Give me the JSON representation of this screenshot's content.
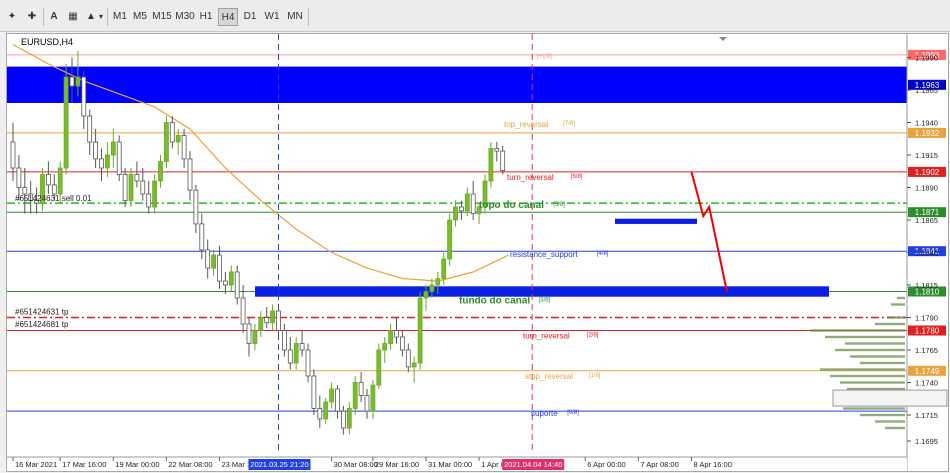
{
  "toolbar": {
    "buttons": [
      "A",
      "M1",
      "M5",
      "M15",
      "M30",
      "H1",
      "H4",
      "D1",
      "W1",
      "MN"
    ],
    "active": "H4"
  },
  "chart": {
    "symbol": "EURUSD,H4"
  },
  "chart_data": {
    "type": "candlestick",
    "symbol": "EURUSD",
    "timeframe": "H4",
    "ylim": [
      1.1685,
      1.2005
    ],
    "y_ticks": [
      1.199,
      1.1965,
      1.194,
      1.1915,
      1.189,
      1.1865,
      1.184,
      1.1815,
      1.179,
      1.1765,
      1.174,
      1.1715,
      1.1695
    ],
    "y_tick_labels": [
      "1.1990",
      "1.1965",
      "1.1940",
      "1.1915",
      "1.1890",
      "1.1865",
      "1.1840",
      "1.1815",
      "1.1790",
      "1.1765",
      "1.1740",
      "1.1715",
      "1.1695"
    ],
    "x_labels": [
      "16 Mar 2021",
      "17 Mar 16:00",
      "19 Mar 00:00",
      "22 Mar 08:00",
      "23 Mar 16:00",
      "2021.03.25 21:20",
      "30 Mar 08:00",
      "29 Mar 16:00",
      "31 Mar 00:00",
      "1 Apr 08:00",
      "2021.04.04 14:40",
      "6 Apr 00:00",
      "7 Apr 08:00",
      "8 Apr 16:00"
    ],
    "x_label_index": [
      0,
      8,
      17,
      26,
      35,
      45,
      54,
      61,
      70,
      79,
      88,
      97,
      106,
      115
    ],
    "candles": [
      [
        1.1925,
        1.194,
        1.1895,
        1.1905
      ],
      [
        1.1905,
        1.1915,
        1.188,
        1.189
      ],
      [
        1.189,
        1.1905,
        1.187,
        1.1885
      ],
      [
        1.1885,
        1.1895,
        1.187,
        1.188
      ],
      [
        1.188,
        1.189,
        1.187,
        1.1878
      ],
      [
        1.1878,
        1.1905,
        1.1872,
        1.19
      ],
      [
        1.19,
        1.191,
        1.1885,
        1.1892
      ],
      [
        1.1892,
        1.19,
        1.188,
        1.1885
      ],
      [
        1.1885,
        1.191,
        1.1878,
        1.1905
      ],
      [
        1.1905,
        1.1985,
        1.19,
        1.1975
      ],
      [
        1.1975,
        1.199,
        1.1955,
        1.1968
      ],
      [
        1.1968,
        1.1995,
        1.196,
        1.1975
      ],
      [
        1.1975,
        1.198,
        1.1935,
        1.1945
      ],
      [
        1.1945,
        1.195,
        1.1915,
        1.1925
      ],
      [
        1.1925,
        1.1935,
        1.1905,
        1.1912
      ],
      [
        1.1912,
        1.192,
        1.1895,
        1.1905
      ],
      [
        1.1905,
        1.1925,
        1.1898,
        1.1915
      ],
      [
        1.1915,
        1.1935,
        1.1905,
        1.1925
      ],
      [
        1.1925,
        1.193,
        1.1895,
        1.19
      ],
      [
        1.19,
        1.1905,
        1.1875,
        1.188
      ],
      [
        1.188,
        1.1905,
        1.1875,
        1.19
      ],
      [
        1.19,
        1.191,
        1.189,
        1.1895
      ],
      [
        1.1895,
        1.1905,
        1.188,
        1.1885
      ],
      [
        1.1885,
        1.1895,
        1.187,
        1.1875
      ],
      [
        1.1875,
        1.19,
        1.187,
        1.1895
      ],
      [
        1.1895,
        1.1915,
        1.189,
        1.191
      ],
      [
        1.191,
        1.1945,
        1.1905,
        1.194
      ],
      [
        1.194,
        1.1945,
        1.192,
        1.1925
      ],
      [
        1.1925,
        1.1935,
        1.1915,
        1.193
      ],
      [
        1.193,
        1.1935,
        1.1905,
        1.1912
      ],
      [
        1.1912,
        1.1918,
        1.188,
        1.1888
      ],
      [
        1.1888,
        1.1892,
        1.1855,
        1.1862
      ],
      [
        1.1862,
        1.187,
        1.1835,
        1.1842
      ],
      [
        1.1842,
        1.185,
        1.182,
        1.1828
      ],
      [
        1.1828,
        1.1842,
        1.1822,
        1.1838
      ],
      [
        1.1838,
        1.1845,
        1.1812,
        1.1818
      ],
      [
        1.1818,
        1.1825,
        1.1808,
        1.1815
      ],
      [
        1.1815,
        1.183,
        1.181,
        1.1825
      ],
      [
        1.1825,
        1.183,
        1.18,
        1.1805
      ],
      [
        1.1805,
        1.1815,
        1.1778,
        1.1785
      ],
      [
        1.1785,
        1.179,
        1.176,
        1.177
      ],
      [
        1.177,
        1.1785,
        1.1765,
        1.178
      ],
      [
        1.178,
        1.1795,
        1.1775,
        1.179
      ],
      [
        1.179,
        1.1798,
        1.1782,
        1.1786
      ],
      [
        1.1786,
        1.18,
        1.178,
        1.1795
      ],
      [
        1.1795,
        1.18,
        1.1775,
        1.178
      ],
      [
        1.178,
        1.1785,
        1.176,
        1.1765
      ],
      [
        1.1765,
        1.1775,
        1.175,
        1.1755
      ],
      [
        1.1755,
        1.1775,
        1.175,
        1.177
      ],
      [
        1.177,
        1.178,
        1.176,
        1.1765
      ],
      [
        1.1765,
        1.177,
        1.174,
        1.1745
      ],
      [
        1.1745,
        1.175,
        1.1715,
        1.172
      ],
      [
        1.172,
        1.173,
        1.1705,
        1.1712
      ],
      [
        1.1712,
        1.1728,
        1.1708,
        1.1725
      ],
      [
        1.1725,
        1.174,
        1.172,
        1.1735
      ],
      [
        1.1735,
        1.1738,
        1.1712,
        1.1718
      ],
      [
        1.1718,
        1.1722,
        1.17,
        1.1705
      ],
      [
        1.1705,
        1.1725,
        1.17,
        1.172
      ],
      [
        1.172,
        1.1745,
        1.1715,
        1.174
      ],
      [
        1.174,
        1.1748,
        1.1725,
        1.173
      ],
      [
        1.173,
        1.1735,
        1.1712,
        1.1718
      ],
      [
        1.1718,
        1.1742,
        1.1712,
        1.1738
      ],
      [
        1.1738,
        1.177,
        1.1735,
        1.1765
      ],
      [
        1.1765,
        1.1775,
        1.1755,
        1.177
      ],
      [
        1.177,
        1.1785,
        1.1765,
        1.178
      ],
      [
        1.178,
        1.179,
        1.177,
        1.1775
      ],
      [
        1.1775,
        1.178,
        1.176,
        1.1765
      ],
      [
        1.1765,
        1.177,
        1.1748,
        1.1752
      ],
      [
        1.1752,
        1.176,
        1.174,
        1.1755
      ],
      [
        1.1755,
        1.181,
        1.175,
        1.1805
      ],
      [
        1.1805,
        1.1815,
        1.1795,
        1.181
      ],
      [
        1.181,
        1.182,
        1.1805,
        1.1815
      ],
      [
        1.1815,
        1.1825,
        1.1808,
        1.182
      ],
      [
        1.182,
        1.184,
        1.1815,
        1.1835
      ],
      [
        1.1835,
        1.187,
        1.183,
        1.1865
      ],
      [
        1.1865,
        1.188,
        1.186,
        1.1875
      ],
      [
        1.1875,
        1.188,
        1.1865,
        1.1872
      ],
      [
        1.1872,
        1.189,
        1.1868,
        1.1885
      ],
      [
        1.1885,
        1.1895,
        1.1865,
        1.187
      ],
      [
        1.187,
        1.1878,
        1.1862,
        1.1875
      ],
      [
        1.1875,
        1.19,
        1.187,
        1.1895
      ],
      [
        1.1895,
        1.1925,
        1.189,
        1.192
      ],
      [
        1.192,
        1.1925,
        1.191,
        1.1918
      ],
      [
        1.1918,
        1.1922,
        1.19,
        1.1903
      ]
    ],
    "ma_line": [
      [
        0,
        1.2
      ],
      [
        6,
        1.1985
      ],
      [
        12,
        1.1972
      ],
      [
        18,
        1.1962
      ],
      [
        24,
        1.1952
      ],
      [
        30,
        1.1935
      ],
      [
        36,
        1.1905
      ],
      [
        42,
        1.188
      ],
      [
        48,
        1.1858
      ],
      [
        54,
        1.184
      ],
      [
        60,
        1.1828
      ],
      [
        66,
        1.182
      ],
      [
        72,
        1.1818
      ],
      [
        78,
        1.1825
      ],
      [
        84,
        1.1838
      ]
    ],
    "horizontal_lines": [
      {
        "price": 1.1992,
        "color": "#ff9999",
        "style": "solid",
        "label": "1.1993",
        "label_color": "#ff6666",
        "tag": "[+1/8]"
      },
      {
        "price": 1.1932,
        "color": "#e8a33a",
        "style": "solid",
        "label": "1.1932",
        "label_color": "#e8a33a",
        "text": "top_reversal",
        "tag": "[7/8]"
      },
      {
        "price": 1.1902,
        "color": "#e02020",
        "style": "solid",
        "label": "1.1902",
        "label_color": "#e02020",
        "text": "turn_reversal",
        "tag": "[6/8]"
      },
      {
        "price": 1.1878,
        "color": "#22bb22",
        "style": "dashdot",
        "label": "",
        "label_color": "#22bb22"
      },
      {
        "price": 1.1871,
        "color": "#2e8b2e",
        "style": "solid",
        "label": "1.1871",
        "label_color": "#2e8b2e",
        "text": "topo do canal",
        "tag": "[5/8]"
      },
      {
        "price": 1.1841,
        "color": "#2040e0",
        "style": "solid",
        "label": "1.1841",
        "label_color": "#2040e0",
        "text": "resistance_support",
        "tag": "[4/8]"
      },
      {
        "price": 1.181,
        "color": "#2e8b2e",
        "style": "solid",
        "label": "1.1810",
        "label_color": "#2e8b2e",
        "text": "fundo do canal",
        "tag": "[3/8]"
      },
      {
        "price": 1.179,
        "color": "#e02020",
        "style": "dashdot",
        "label": "",
        "label_color": "#e02020"
      },
      {
        "price": 1.178,
        "color": "#e02020",
        "style": "solid",
        "label": "1.1780",
        "label_color": "#e02020",
        "text": "turn_reversal",
        "tag": "[2/8]"
      },
      {
        "price": 1.1749,
        "color": "#e8a33a",
        "style": "solid",
        "label": "1.1749",
        "label_color": "#e8a33a",
        "text": "stop_reversal",
        "tag": "[1/8]"
      },
      {
        "price": 1.1718,
        "color": "#2040e0",
        "style": "solid",
        "label": "",
        "label_color": "#2040e0",
        "text": "suporte",
        "tag": "[0/8]"
      }
    ],
    "zones": [
      {
        "from": 1.1983,
        "to": 1.1955,
        "color": "#0000ff",
        "label": "1.1963"
      },
      {
        "from": 1.1814,
        "to": 1.1806,
        "color": "#0a1fe0",
        "label": ""
      },
      {
        "from": 1.1866,
        "to": 1.1862,
        "color": "#0a1fe0",
        "label": ""
      }
    ],
    "order_labels": [
      "#651424631 sell 0.01",
      "#651424631 tp",
      "#651424681 tp"
    ],
    "vertical_lines": [
      {
        "index": 45,
        "color": "#2040e0",
        "label": "2021.03.25 21:20"
      },
      {
        "index": 88,
        "color": "#e0306a",
        "label": "2021.04.04 14:40"
      }
    ],
    "projection": [
      [
        115,
        1.1902
      ],
      [
        117,
        1.1868
      ],
      [
        118,
        1.1875
      ],
      [
        121,
        1.181
      ]
    ]
  }
}
